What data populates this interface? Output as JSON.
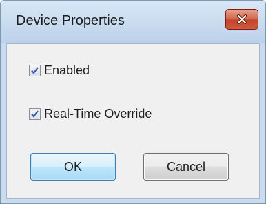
{
  "window": {
    "title": "Device Properties"
  },
  "checkboxes": [
    {
      "label": "Enabled",
      "checked": true
    },
    {
      "label": "Real-Time Override",
      "checked": true
    }
  ],
  "buttons": {
    "ok_label": "OK",
    "cancel_label": "Cancel"
  },
  "icons": {
    "close": "close-icon",
    "check": "check-icon"
  },
  "colors": {
    "close_button": "#c7492d",
    "client_background": "#f0f0f0",
    "titlebar": "#c7daee",
    "ok_button_accent": "#3c7fb1"
  }
}
